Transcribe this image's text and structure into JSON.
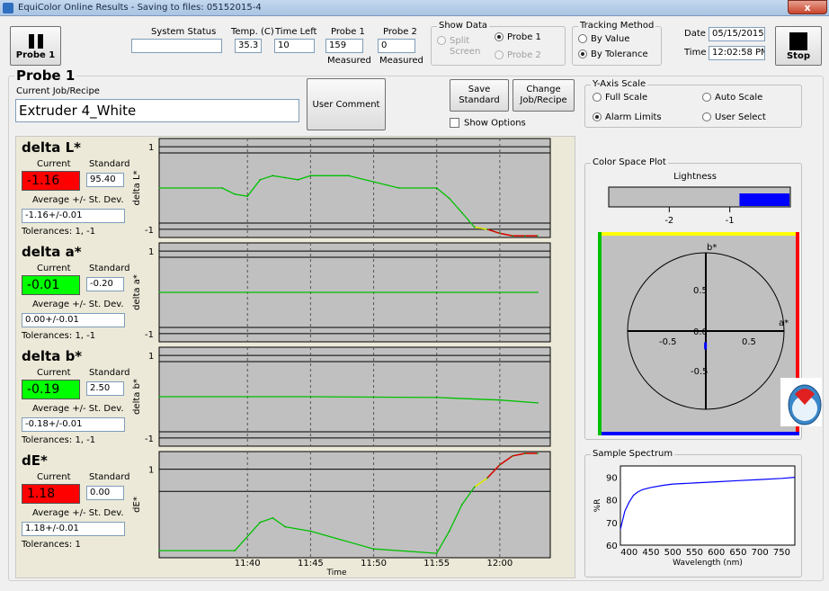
{
  "window": {
    "title": "EquiColor Online Results - Saving to files: 05152015-4",
    "close": "x"
  },
  "toolbar": {
    "probe_button": "Probe 1",
    "system_status": {
      "label": "System Status",
      "value": ""
    },
    "temp": {
      "label": "Temp. (C)",
      "value": "35.3"
    },
    "time_left": {
      "label": "Time Left",
      "value": "10"
    },
    "probe1": {
      "label": "Probe 1",
      "value": "159",
      "sub": "Measured"
    },
    "probe2": {
      "label": "Probe 2",
      "value": "0",
      "sub": "Measured"
    },
    "show_data": {
      "title": "Show Data",
      "split": "Split Screen",
      "probe1": "Probe 1",
      "probe2": "Probe 2",
      "selected": "Probe 1"
    },
    "tracking": {
      "title": "Tracking Method",
      "by_value": "By Value",
      "by_tolerance": "By Tolerance",
      "selected": "By Tolerance"
    },
    "date": {
      "label": "Date",
      "value": "05/15/2015"
    },
    "time": {
      "label": "Time",
      "value": "12:02:58 PM"
    },
    "stop": "Stop"
  },
  "probe_section": {
    "title": "Probe 1",
    "job_label": "Current Job/Recipe",
    "job_value": "Extruder 4_White",
    "user_comment": "User Comment",
    "save_standard": "Save Standard",
    "change_job": "Change Job/Recipe",
    "show_options": "Show Options"
  },
  "yaxis_scale": {
    "title": "Y-Axis Scale",
    "full": "Full Scale",
    "auto": "Auto Scale",
    "alarm": "Alarm Limits",
    "user": "User Select",
    "selected": "Alarm Limits"
  },
  "metrics": [
    {
      "name": "delta L*",
      "current_label": "Current",
      "standard_label": "Standard",
      "current": "-1.16",
      "standard": "95.40",
      "avg_label": "Average +/- St. Dev.",
      "avg": "-1.16+/-0.01",
      "tolerances": "Tolerances:  1, -1",
      "status_color": "#ff0000",
      "ylabel": "delta L*",
      "ytick_top": "1",
      "ytick_bottom": "-1"
    },
    {
      "name": "delta a*",
      "current_label": "Current",
      "standard_label": "Standard",
      "current": "-0.01",
      "standard": "-0.20",
      "avg_label": "Average +/- St. Dev.",
      "avg": "0.00+/-0.01",
      "tolerances": "Tolerances:  1, -1",
      "status_color": "#00ff00",
      "ylabel": "delta a*",
      "ytick_top": "1",
      "ytick_bottom": "-1"
    },
    {
      "name": "delta b*",
      "current_label": "Current",
      "standard_label": "Standard",
      "current": "-0.19",
      "standard": "2.50",
      "avg_label": "Average +/- St. Dev.",
      "avg": "-0.18+/-0.01",
      "tolerances": "Tolerances:  1, -1",
      "status_color": "#00ff00",
      "ylabel": "delta b*",
      "ytick_top": "1",
      "ytick_bottom": "-1"
    },
    {
      "name": "dE*",
      "current_label": "Current",
      "standard_label": "Standard",
      "current": "1.18",
      "standard": "0.00",
      "avg_label": "Average +/- St. Dev.",
      "avg": "1.18+/-0.01",
      "tolerances": "Tolerances:  1",
      "status_color": "#ff0000",
      "ylabel": "dE*",
      "ytick_top": "1",
      "ytick_bottom": ""
    }
  ],
  "time_axis": {
    "label": "Time",
    "ticks": [
      "11:40",
      "11:45",
      "11:50",
      "11:55",
      "12:00"
    ]
  },
  "color_space": {
    "title": "Color Space Plot",
    "lightness_label": "Lightness",
    "lightness_ticks": [
      "-2",
      "-1"
    ],
    "lightness_value": -0.84,
    "b_label": "b*",
    "a_label": "a*",
    "ticks_pos": [
      "0.5",
      "0.5"
    ],
    "ticks_neg": [
      "-0.5",
      "-0.5"
    ],
    "center": "0.0",
    "point": {
      "a": -0.01,
      "b": -0.19
    }
  },
  "spectrum": {
    "title": "Sample Spectrum",
    "ylabel": "%R",
    "xlabel": "Wavelength (nm)",
    "xticks": [
      "400",
      "450",
      "500",
      "550",
      "600",
      "650",
      "700",
      "750"
    ],
    "yticks": [
      "90",
      "80",
      "70",
      "60"
    ],
    "color": "#0000ff"
  },
  "chart_data": [
    {
      "type": "line",
      "title": "delta L*",
      "xlabel": "",
      "ylabel": "delta L*",
      "ylim": [
        -1.2,
        1.2
      ],
      "x": [
        "11:33",
        "11:38",
        "11:39",
        "11:40",
        "11:41",
        "11:42",
        "11:43",
        "11:44",
        "11:45",
        "11:48",
        "11:52",
        "11:55",
        "11:56",
        "11:57",
        "11:58",
        "11:59",
        "12:00",
        "12:01",
        "12:02",
        "12:03"
      ],
      "values": [
        0.0,
        0.0,
        -0.15,
        -0.2,
        0.2,
        0.3,
        0.25,
        0.2,
        0.3,
        0.3,
        0.0,
        0.0,
        -0.25,
        -0.6,
        -0.95,
        -1.0,
        -1.1,
        -1.16,
        -1.16,
        -1.16
      ],
      "colors_by_tolerance": {
        "green": "#00c000",
        "yellow": "#e8e800",
        "red": "#e00000"
      }
    },
    {
      "type": "line",
      "title": "delta a*",
      "ylabel": "delta a*",
      "ylim": [
        -1.2,
        1.2
      ],
      "x": [
        "11:33",
        "11:45",
        "11:55",
        "12:03"
      ],
      "values": [
        0.0,
        0.0,
        0.0,
        0.0
      ]
    },
    {
      "type": "line",
      "title": "delta b*",
      "ylabel": "delta b*",
      "ylim": [
        -1.2,
        1.2
      ],
      "x": [
        "11:33",
        "11:45",
        "11:55",
        "12:00",
        "12:03"
      ],
      "values": [
        0.0,
        0.0,
        -0.02,
        -0.08,
        -0.15
      ]
    },
    {
      "type": "line",
      "title": "dE*",
      "ylabel": "dE*",
      "ylim": [
        0,
        1.2
      ],
      "x": [
        "11:33",
        "11:39",
        "11:41",
        "11:42",
        "11:43",
        "11:45",
        "11:50",
        "11:55",
        "11:56",
        "11:57",
        "11:58",
        "11:59",
        "12:00",
        "12:01",
        "12:02",
        "12:03"
      ],
      "values": [
        0.08,
        0.08,
        0.4,
        0.45,
        0.35,
        0.3,
        0.1,
        0.05,
        0.3,
        0.6,
        0.8,
        0.9,
        1.05,
        1.15,
        1.18,
        1.18
      ]
    },
    {
      "type": "line",
      "title": "Sample Spectrum",
      "xlabel": "Wavelength (nm)",
      "ylabel": "%R",
      "xlim": [
        380,
        780
      ],
      "ylim": [
        60,
        95
      ],
      "x": [
        380,
        390,
        400,
        410,
        420,
        430,
        450,
        480,
        500,
        550,
        600,
        650,
        700,
        750,
        780
      ],
      "values": [
        67,
        75,
        79,
        82,
        83.5,
        84.5,
        85.5,
        86.5,
        87,
        87.5,
        88,
        88.5,
        89,
        89.5,
        90
      ]
    }
  ]
}
